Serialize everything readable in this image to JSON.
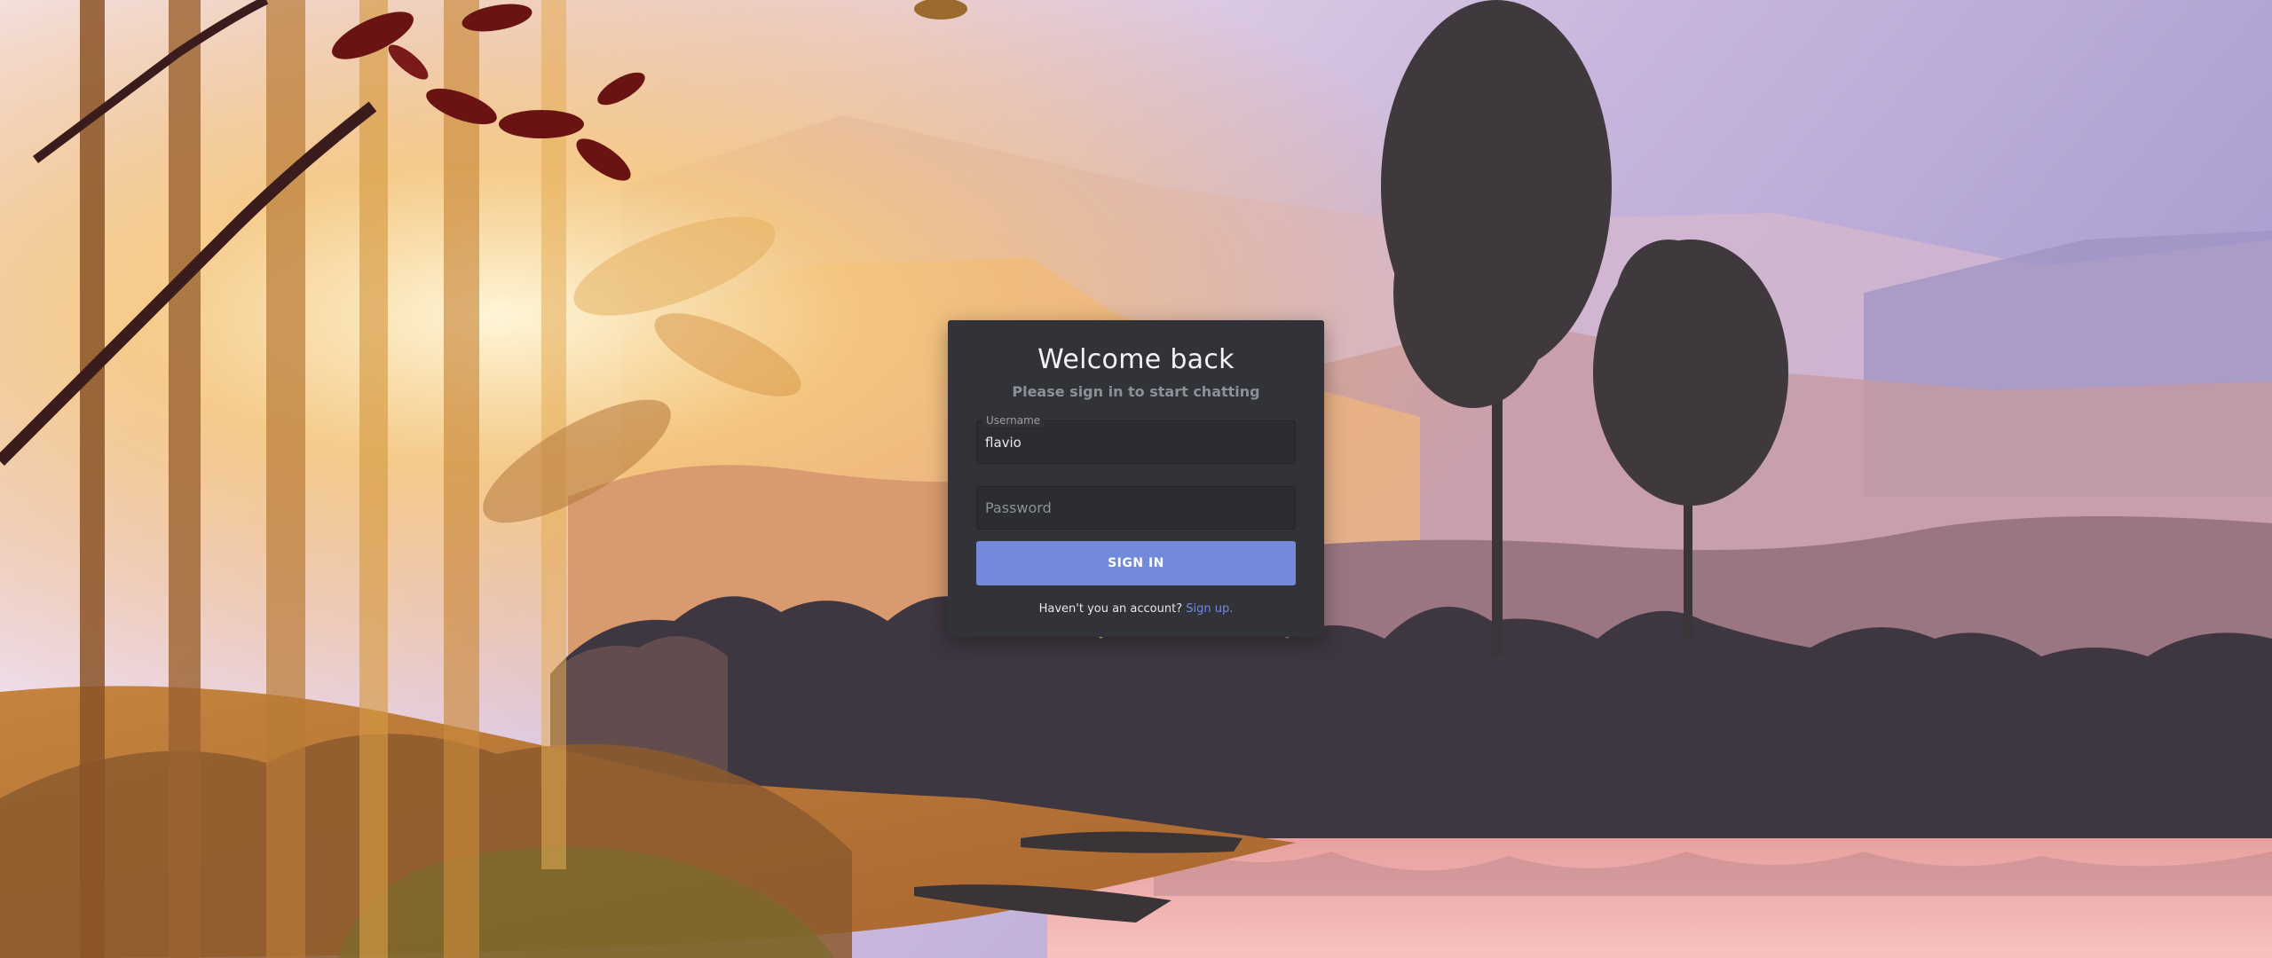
{
  "login": {
    "title": "Welcome back",
    "subtitle": "Please sign in to start chatting",
    "username": {
      "label": "Username",
      "value": "flavio"
    },
    "password": {
      "placeholder": "Password",
      "value": ""
    },
    "signin_label": "SIGN IN",
    "signup_prompt": "Haven't you an account?",
    "signup_link": "Sign up."
  },
  "colors": {
    "card_background": "#313338",
    "button_accent": "#7389dc",
    "link_accent": "#7389dc",
    "subtitle_text": "#8d9097"
  }
}
